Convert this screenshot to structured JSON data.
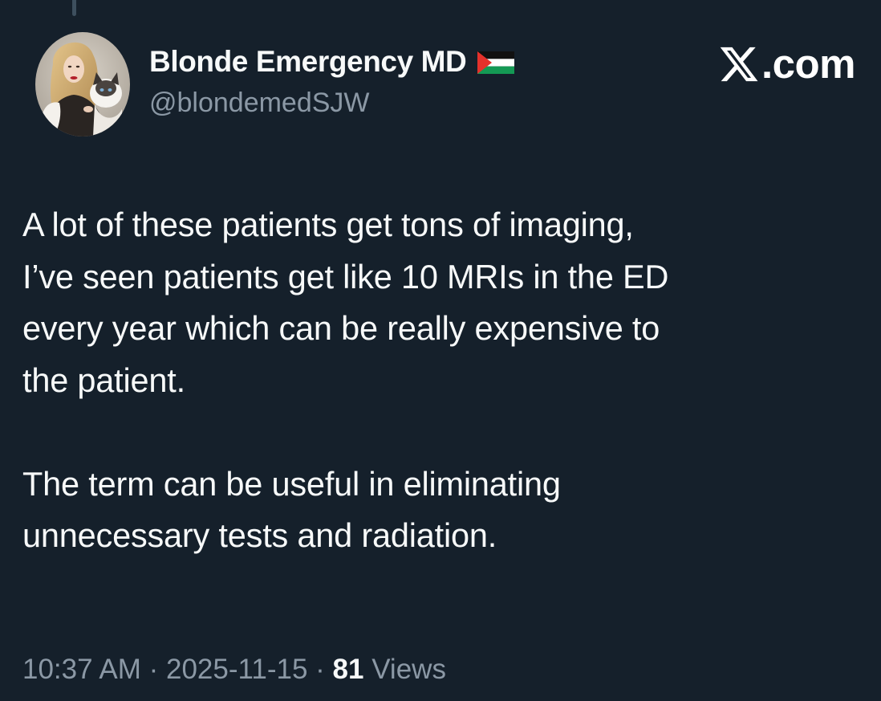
{
  "author": {
    "display_name": "Blonde Emergency MD",
    "flag_icon": "palestine-flag-icon",
    "handle": "@blondemedSJW",
    "avatar_icon": "profile-avatar"
  },
  "site": {
    "logo_icon": "x-logo-icon",
    "domain_text": ".com"
  },
  "tweet": {
    "paragraphs": [
      "A lot of these patients get tons of imaging,\nI’ve seen patients get like 10 MRIs in the ED\nevery year which can be really expensive to\nthe patient.",
      "The term can be useful in eliminating\nunnecessary tests and radiation."
    ]
  },
  "meta": {
    "time": "10:37 AM",
    "separator": " · ",
    "date": "2025-11-15",
    "views_count": "81",
    "views_label": "Views"
  },
  "colors": {
    "background": "#15202b",
    "text_primary": "#f7f9f9",
    "text_secondary": "#8b98a5"
  }
}
